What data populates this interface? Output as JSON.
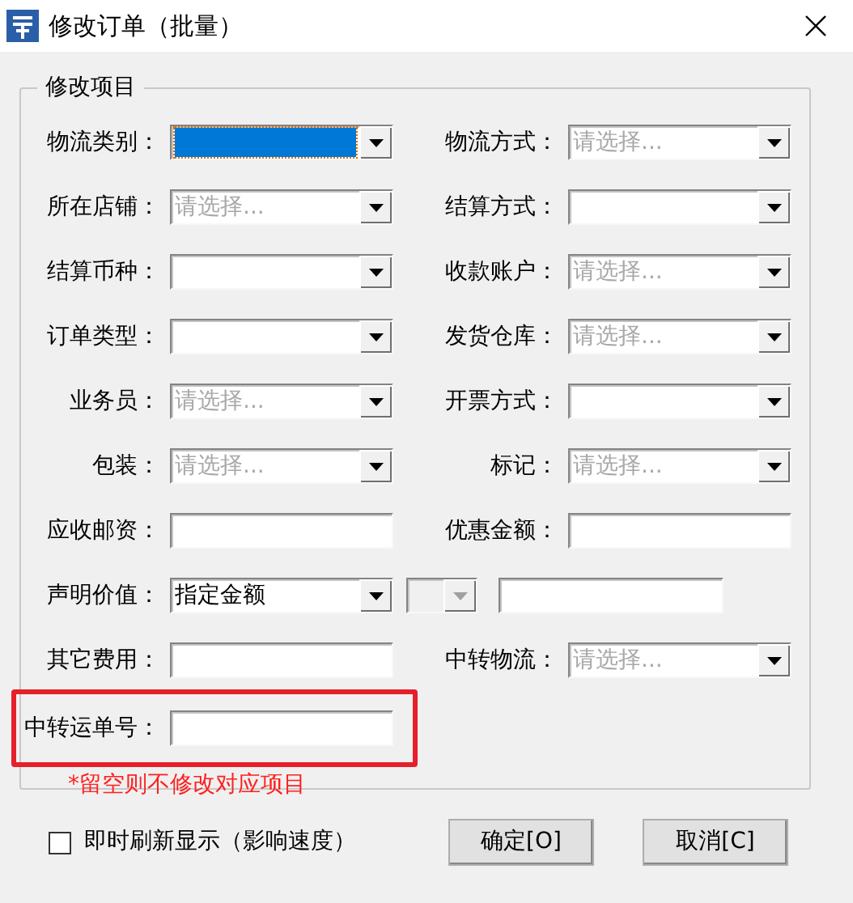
{
  "window": {
    "title": "修改订单（批量）"
  },
  "group": {
    "legend": "修改项目",
    "rows": [
      {
        "highlighted": false,
        "fields": [
          {
            "label": "物流类别：",
            "kind": "select",
            "selected": true,
            "disabled": false
          },
          {
            "label": "物流方式：",
            "kind": "select",
            "placeholder": "请选择...",
            "selected": false,
            "disabled": false
          }
        ]
      },
      {
        "highlighted": false,
        "fields": [
          {
            "label": "所在店铺：",
            "kind": "select",
            "placeholder": "请选择...",
            "selected": false,
            "disabled": false
          },
          {
            "label": "结算方式：",
            "kind": "select",
            "selected": false,
            "disabled": false
          }
        ]
      },
      {
        "highlighted": false,
        "fields": [
          {
            "label": "结算币种：",
            "kind": "select",
            "selected": false,
            "disabled": false
          },
          {
            "label": "收款账户：",
            "kind": "select",
            "placeholder": "请选择...",
            "selected": false,
            "disabled": false
          }
        ]
      },
      {
        "highlighted": false,
        "fields": [
          {
            "label": "订单类型：",
            "kind": "select",
            "selected": false,
            "disabled": false
          },
          {
            "label": "发货仓库：",
            "kind": "select",
            "placeholder": "请选择...",
            "selected": false,
            "disabled": false
          }
        ]
      },
      {
        "highlighted": false,
        "fields": [
          {
            "label": "业务员：",
            "kind": "select",
            "placeholder": "请选择...",
            "selected": false,
            "disabled": false
          },
          {
            "label": "开票方式：",
            "kind": "select",
            "selected": false,
            "disabled": false
          }
        ]
      },
      {
        "highlighted": false,
        "fields": [
          {
            "label": "包装：",
            "kind": "select",
            "placeholder": "请选择...",
            "selected": false,
            "disabled": false
          },
          {
            "label": "标记：",
            "kind": "select",
            "placeholder": "请选择...",
            "selected": false,
            "disabled": false
          }
        ]
      },
      {
        "highlighted": false,
        "fields": [
          {
            "label": "应收邮资：",
            "kind": "text"
          },
          {
            "label": "优惠金额：",
            "kind": "text"
          }
        ]
      },
      {
        "highlighted": false,
        "fields": [
          {
            "label": "声明价值：",
            "kind": "select",
            "value": "指定金额",
            "selected": false,
            "disabled": false
          },
          {
            "kind": "select",
            "selected": false,
            "disabled": true
          },
          {
            "kind": "text"
          }
        ]
      },
      {
        "highlighted": false,
        "fields": [
          {
            "label": "其它费用：",
            "kind": "text"
          },
          {
            "label": "中转物流：",
            "kind": "select",
            "placeholder": "请选择...",
            "selected": false,
            "disabled": false
          }
        ]
      },
      {
        "highlighted": true,
        "fields": [
          {
            "label": "中转运单号：",
            "kind": "text"
          }
        ]
      }
    ],
    "note": "*留空则不修改对应项目"
  },
  "checkbox": {
    "label": "即时刷新显示（影响速度）",
    "checked": false
  },
  "buttons": [
    "确定[O]",
    "取消[C]"
  ]
}
